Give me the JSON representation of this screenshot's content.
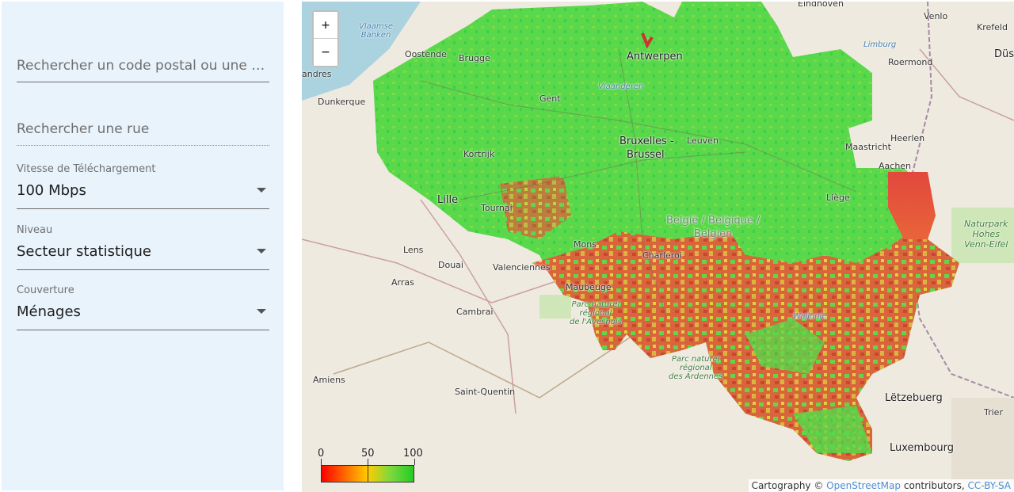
{
  "sidebar": {
    "postal_search": {
      "placeholder": "Rechercher un code postal ou une c..."
    },
    "street_search": {
      "placeholder": "Rechercher une rue"
    },
    "speed": {
      "label": "Vitesse de Téléchargement",
      "value": "100 Mbps"
    },
    "level": {
      "label": "Niveau",
      "value": "Secteur statistique"
    },
    "coverage": {
      "label": "Couverture",
      "value": "Ménages"
    }
  },
  "map": {
    "zoom_in": "+",
    "zoom_out": "−",
    "places": {
      "antwerpen": "Antwerpen",
      "brugge": "Brugge",
      "oostende": "Oostende",
      "gent": "Gent",
      "vlaanderen": "Vlaanderen",
      "bruxelles1": "Bruxelles -",
      "bruxelles2": "Brussel",
      "leuven": "Leuven",
      "kortrijk": "Kortrijk",
      "tournai": "Tournai",
      "lille": "Lille",
      "mons": "Mons",
      "charleroi": "Charleroi",
      "liege": "Liège",
      "maastricht": "Maastricht",
      "heerlen": "Heerlen",
      "aachen": "Aachen",
      "limburg": "Limburg",
      "roermond": "Roermond",
      "venlo": "Venlo",
      "krefeld": "Krefeld",
      "dus": "Düs",
      "dunkerque": "Dunkerque",
      "lens": "Lens",
      "douai": "Douai",
      "arras": "Arras",
      "valenciennes": "Valenciennes",
      "maubeuge": "Maubeuge",
      "cambrai": "Cambrai",
      "amiens": "Amiens",
      "saint_quentin": "Saint-Quentin",
      "letzebuerg": "Lëtzebuerg",
      "luxembourg": "Luxembourg",
      "trier": "Trier",
      "eindhoven": "Eindhoven",
      "andres": "andres",
      "wallonie": "Wallonie"
    },
    "country_label": [
      "België / Belgique /",
      "Belgien"
    ],
    "water": [
      "Vlaamse",
      "Banken"
    ],
    "parks": {
      "avesnois": [
        "Parc naturel",
        "régional",
        "de l'Avesnois"
      ],
      "ardennes": [
        "Parc naturel",
        "régional",
        "des Ardennes"
      ],
      "hohes_venn": [
        "Naturpark",
        "Hohes",
        "Venn-Eifel"
      ]
    },
    "legend": {
      "min": "0",
      "mid": "50",
      "max": "100",
      "colors": [
        "#ff0000",
        "#ffcc00",
        "#22cc22"
      ]
    },
    "attribution": {
      "prefix": "Cartography ©",
      "osm": "OpenStreetMap",
      "middle": "contributors,",
      "license": "CC-BY-SA"
    }
  }
}
